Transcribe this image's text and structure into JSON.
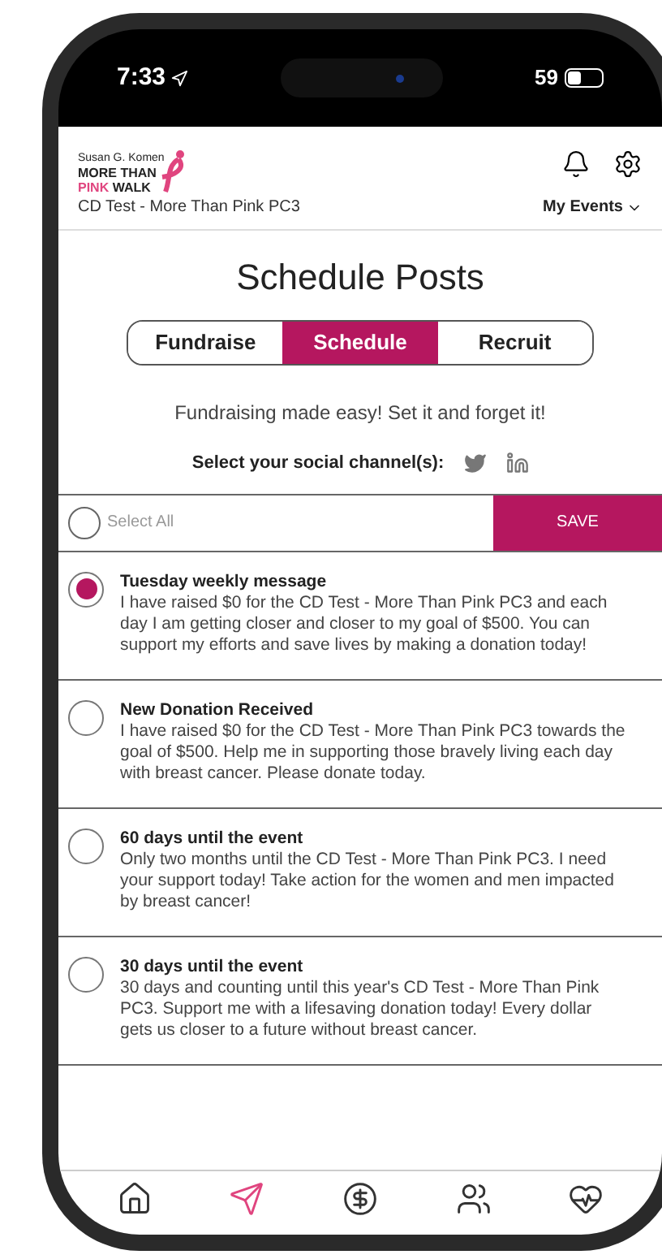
{
  "status_bar": {
    "time": "7:33",
    "battery": "59"
  },
  "header": {
    "logo": {
      "line_1": "Susan G. Komen",
      "line_2": "MORE THAN",
      "line_3_accent": "PINK",
      "line_3": "WALK"
    },
    "event_name": "CD Test - More Than Pink PC3",
    "menu": "My Events"
  },
  "title": "Schedule Posts",
  "tabs": [
    {
      "label": "Fundraise",
      "selected": false
    },
    {
      "label": "Schedule",
      "selected": true
    },
    {
      "label": "Recruit",
      "selected": false
    }
  ],
  "tagline": "Fundraising made easy! Set it and forget it!",
  "social": {
    "label": "Select your social channel(s):"
  },
  "select_all": {
    "label": "Select All",
    "checked": false
  },
  "save_button": "SAVE",
  "messages": [
    {
      "title": "Tuesday weekly message",
      "body": "I have raised $0 for the CD Test - More Than Pink PC3 and each day I am getting closer and closer to my goal of $500. You can support my efforts and save lives by making a donation today!",
      "selected": true
    },
    {
      "title": "New Donation Received",
      "body": "I have raised $0 for the CD Test - More Than Pink PC3 towards the goal of $500. Help me in supporting those bravely living each day with breast cancer. Please donate today.",
      "selected": false
    },
    {
      "title": "60 days until the event",
      "body": "Only two months until the CD Test - More Than Pink PC3. I need your support today! Take action for the women and men impacted by breast cancer!",
      "selected": false
    },
    {
      "title": "30 days until the event",
      "body": "30 days and counting until this year's CD Test - More Than Pink PC3. Support me with a lifesaving donation today! Every dollar gets us closer to a future without breast cancer.",
      "selected": false
    }
  ],
  "nav": [
    {
      "kind": "home",
      "selected": false
    },
    {
      "kind": "send",
      "selected": true
    },
    {
      "kind": "dollar",
      "selected": false
    },
    {
      "kind": "people",
      "selected": false
    },
    {
      "kind": "health",
      "selected": false
    }
  ]
}
